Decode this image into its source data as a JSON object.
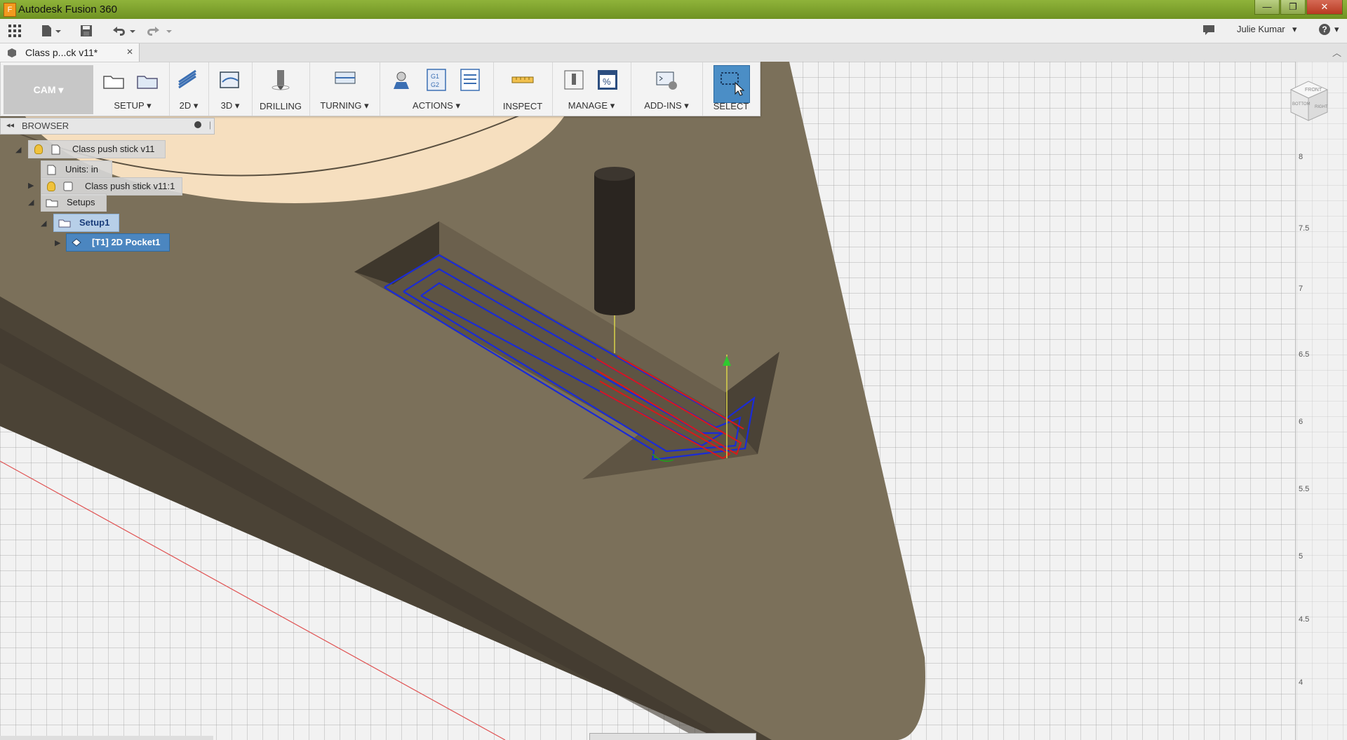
{
  "app": {
    "title": "Autodesk Fusion 360",
    "icon": "fusion-app-icon"
  },
  "window_controls": {
    "minimize": "—",
    "maximize": "❐",
    "close": "✕"
  },
  "menubar": {
    "user_name": "Julie Kumar",
    "help_label": "?"
  },
  "doc_tab": {
    "label": "Class p...ck v11*",
    "close": "✕"
  },
  "toolbar": {
    "workspace": "CAM",
    "groups": [
      {
        "label": "SETUP",
        "dropdown": true
      },
      {
        "label": "2D",
        "dropdown": true
      },
      {
        "label": "3D",
        "dropdown": true
      },
      {
        "label": "DRILLING",
        "dropdown": false
      },
      {
        "label": "TURNING",
        "dropdown": true
      },
      {
        "label": "ACTIONS",
        "dropdown": true
      },
      {
        "label": "INSPECT",
        "dropdown": false
      },
      {
        "label": "MANAGE",
        "dropdown": true
      },
      {
        "label": "ADD-INS",
        "dropdown": true
      },
      {
        "label": "SELECT",
        "dropdown": false
      }
    ],
    "gcode_icon_text": "G1\nG2",
    "percent_icon_text": "%"
  },
  "browser": {
    "title": "BROWSER",
    "items": [
      {
        "label": "Class push stick v11"
      },
      {
        "label": "Units: in"
      },
      {
        "label": "Class push stick v11:1"
      },
      {
        "label": "Setups"
      },
      {
        "label": "Setup1"
      },
      {
        "label": "[T1] 2D Pocket1"
      }
    ]
  },
  "ruler": {
    "ticks": [
      "8",
      "7.5",
      "7",
      "6.5",
      "6",
      "5.5",
      "5",
      "4.5",
      "4"
    ]
  },
  "viewcube": {
    "faces": [
      "FRONT",
      "RIGHT",
      "BOTTOM"
    ]
  },
  "colors": {
    "titlebar": "#7fa22c",
    "part_top": "#7a6e58",
    "part_side": "#4a4234",
    "toolpath_blue": "#1a2bd6",
    "toolpath_red": "#d81a1a",
    "active_blue": "#4b86c0"
  }
}
